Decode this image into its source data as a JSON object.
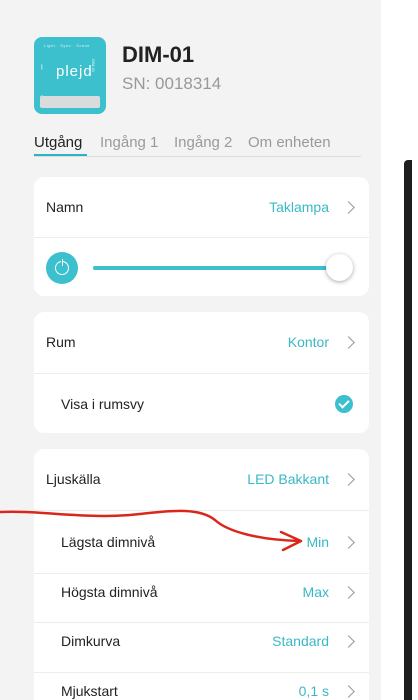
{
  "device": {
    "name": "DIM-01",
    "serial": "SN: 0018314",
    "image_logo": "plejd",
    "image_top_text": "Light · Sync · Scene",
    "image_side_text": "DIM-01"
  },
  "tabs": [
    {
      "label": "Utgång",
      "active": true
    },
    {
      "label": "Ingång 1",
      "active": false
    },
    {
      "label": "Ingång 2",
      "active": false
    },
    {
      "label": "Om enheten",
      "active": false
    }
  ],
  "card1": {
    "name_label": "Namn",
    "name_value": "Taklampa",
    "dim_level": 1.0
  },
  "card2": {
    "room_label": "Rum",
    "room_value": "Kontor",
    "show_in_room_label": "Visa i rumsvy",
    "show_in_room_checked": true
  },
  "card3": {
    "light_source_label": "Ljuskälla",
    "light_source_value": "LED Bakkant",
    "min_dim_label": "Lägsta dimnivå",
    "min_dim_value": "Min",
    "max_dim_label": "Högsta dimnivå",
    "max_dim_value": "Max",
    "dim_curve_label": "Dimkurva",
    "dim_curve_value": "Standard",
    "soft_start_label": "Mjukstart",
    "soft_start_value": "0,1 s"
  },
  "colors": {
    "accent": "#3cc0cd",
    "annotation": "#d9271c"
  },
  "icons": [
    "power-icon",
    "chevron-right-icon",
    "checkmark-icon",
    "bluetooth-icon"
  ]
}
